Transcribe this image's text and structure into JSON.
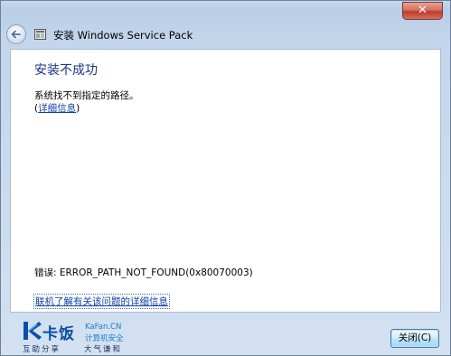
{
  "window": {
    "close_glyph": "✕",
    "title": "安装 Windows Service Pack"
  },
  "content": {
    "heading": "安装不成功",
    "message": "系统找不到指定的路径。",
    "details_open": "(",
    "details_link": "详细信息",
    "details_close": ")",
    "error_text": "错误: ERROR_PATH_NOT_FOUND(0x80070003)",
    "online_link": "联机了解有关该问题的详细信息"
  },
  "footer": {
    "close_button": "关闭(C)"
  },
  "watermark": {
    "brand_cn": "卡饭",
    "brand_en": "KaFan.CN",
    "subtitle": "计算机安全",
    "slogan_left": "互助分享",
    "slogan_right": "大气谦和"
  },
  "colors": {
    "heading": "#1e3287",
    "link": "#0f41a8",
    "brand": "#0c4fa3"
  },
  "icons": {
    "back": "back-arrow-icon",
    "app": "windows-update-icon",
    "close": "close-icon"
  }
}
